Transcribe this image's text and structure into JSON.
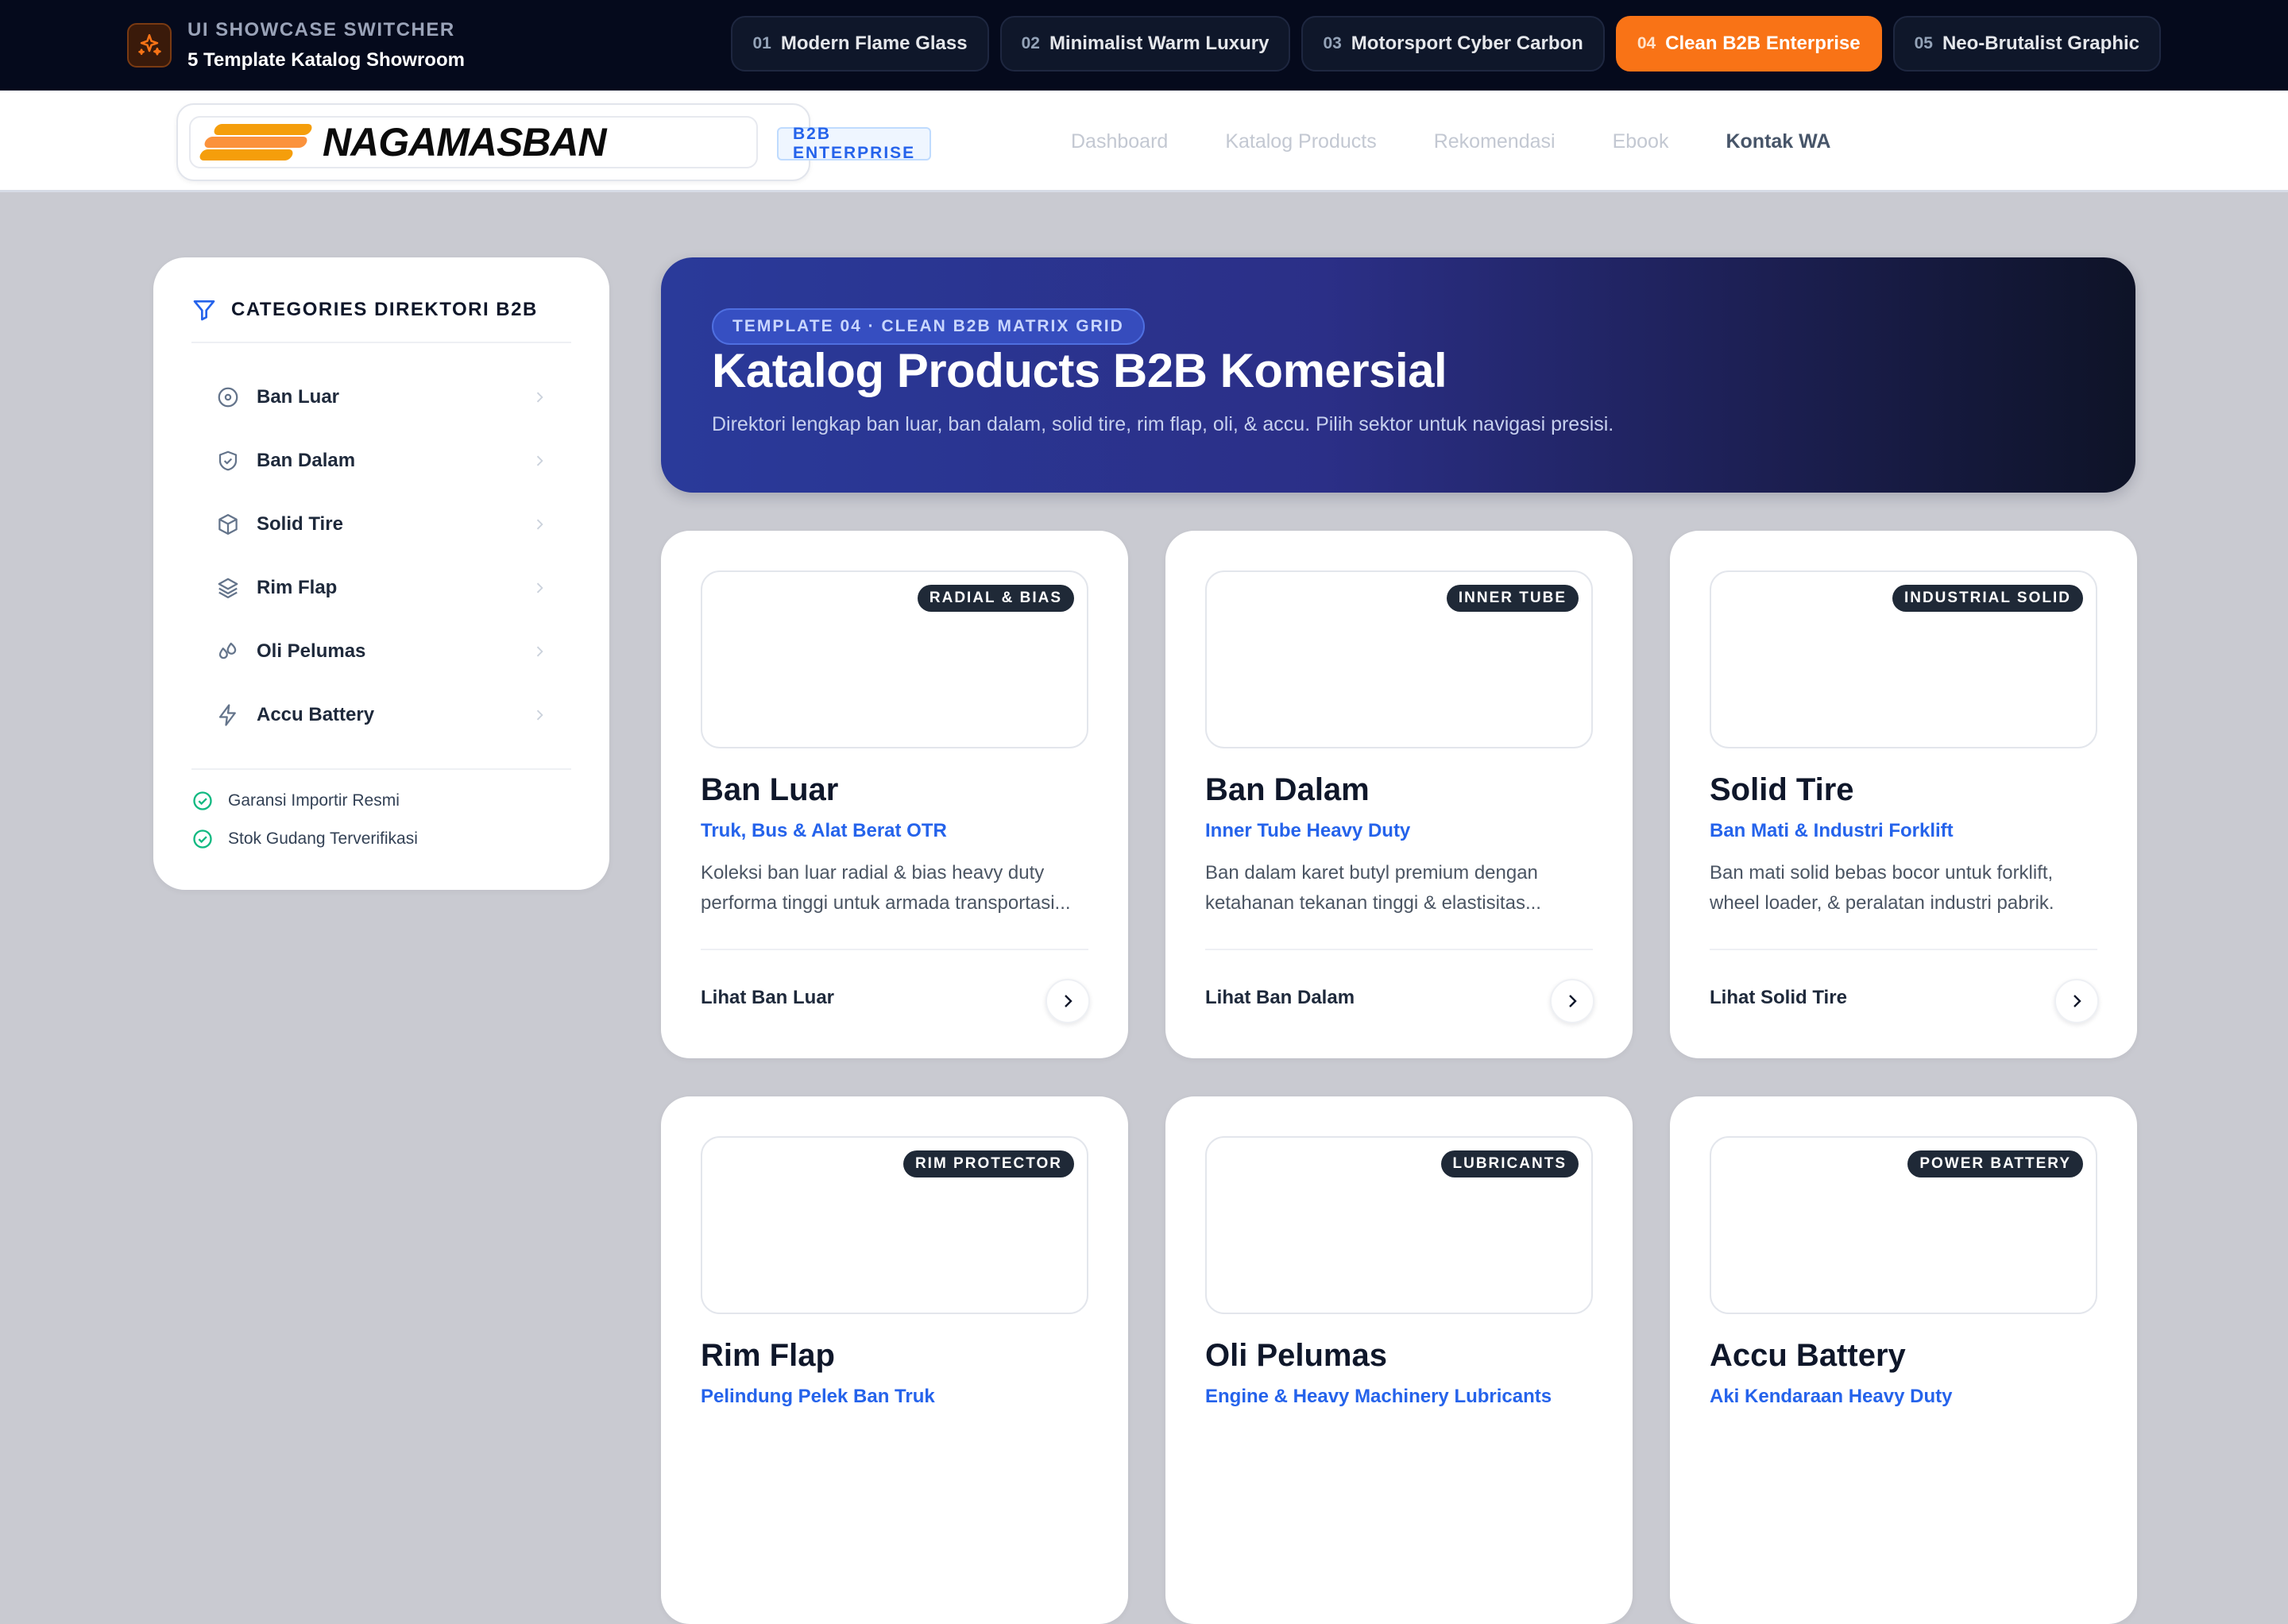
{
  "switcher": {
    "eyebrow": "UI SHOWCASE SWITCHER",
    "title": "5 Template Katalog Showroom",
    "logo_icon": "sparkles-icon",
    "tabs": [
      {
        "num": "01",
        "label": "Modern Flame Glass"
      },
      {
        "num": "02",
        "label": "Minimalist Warm Luxury"
      },
      {
        "num": "03",
        "label": "Motorsport Cyber Carbon"
      },
      {
        "num": "04",
        "label": "Clean B2B Enterprise",
        "active": true
      },
      {
        "num": "05",
        "label": "Neo-Brutalist Graphic"
      }
    ],
    "accent_color": "#f97316"
  },
  "header": {
    "logo_text": "NAGAMASBAN",
    "badge": "B2B ENTERPRISE",
    "nav": [
      {
        "label": "Dashboard"
      },
      {
        "label": "Katalog Products"
      },
      {
        "label": "Rekomendasi"
      },
      {
        "label": "Ebook"
      },
      {
        "label": "Kontak WA",
        "active": true
      }
    ]
  },
  "sidebar": {
    "title": "CATEGORIES DIREKTORI B2B",
    "title_icon": "filter-icon",
    "items": [
      {
        "label": "Ban Luar",
        "icon": "disc-icon"
      },
      {
        "label": "Ban Dalam",
        "icon": "shield-check-icon"
      },
      {
        "label": "Solid Tire",
        "icon": "box-icon"
      },
      {
        "label": "Rim Flap",
        "icon": "layers-icon"
      },
      {
        "label": "Oli Pelumas",
        "icon": "droplets-icon"
      },
      {
        "label": "Accu Battery",
        "icon": "zap-icon"
      }
    ],
    "features": [
      {
        "label": "Garansi Importir Resmi",
        "icon": "check-circle-icon"
      },
      {
        "label": "Stok Gudang Terverifikasi",
        "icon": "check-circle-icon"
      }
    ]
  },
  "hero": {
    "tag": "TEMPLATE 04 · CLEAN B2B MATRIX GRID",
    "title": "Katalog Products B2B Komersial",
    "subtitle": "Direktori lengkap ban luar, ban dalam, solid tire, rim flap, oli, & accu. Pilih sektor untuk navigasi presisi."
  },
  "cards": [
    {
      "badge": "RADIAL & BIAS",
      "title": "Ban Luar",
      "subtitle": "Truk, Bus & Alat Berat OTR",
      "desc": "Koleksi ban luar radial & bias heavy duty performa tinggi untuk armada transportasi...",
      "link": "Lihat Ban Luar"
    },
    {
      "badge": "INNER TUBE",
      "title": "Ban Dalam",
      "subtitle": "Inner Tube Heavy Duty",
      "desc": "Ban dalam karet butyl premium dengan ketahanan tekanan tinggi & elastisitas...",
      "link": "Lihat Ban Dalam"
    },
    {
      "badge": "INDUSTRIAL SOLID",
      "title": "Solid Tire",
      "subtitle": "Ban Mati & Industri Forklift",
      "desc": "Ban mati solid bebas bocor untuk forklift, wheel loader, & peralatan industri pabrik.",
      "link": "Lihat Solid Tire"
    },
    {
      "badge": "RIM PROTECTOR",
      "title": "Rim Flap",
      "subtitle": "Pelindung Pelek Ban Truk",
      "desc": "",
      "link": ""
    },
    {
      "badge": "LUBRICANTS",
      "title": "Oli Pelumas",
      "subtitle": "Engine & Heavy Machinery Lubricants",
      "desc": "",
      "link": ""
    },
    {
      "badge": "POWER BATTERY",
      "title": "Accu Battery",
      "subtitle": "Aki Kendaraan Heavy Duty",
      "desc": "",
      "link": ""
    }
  ],
  "colors": {
    "brand_blue": "#2563eb",
    "logo_orange": "#f59e0b",
    "card_badge": "#1f2937"
  }
}
